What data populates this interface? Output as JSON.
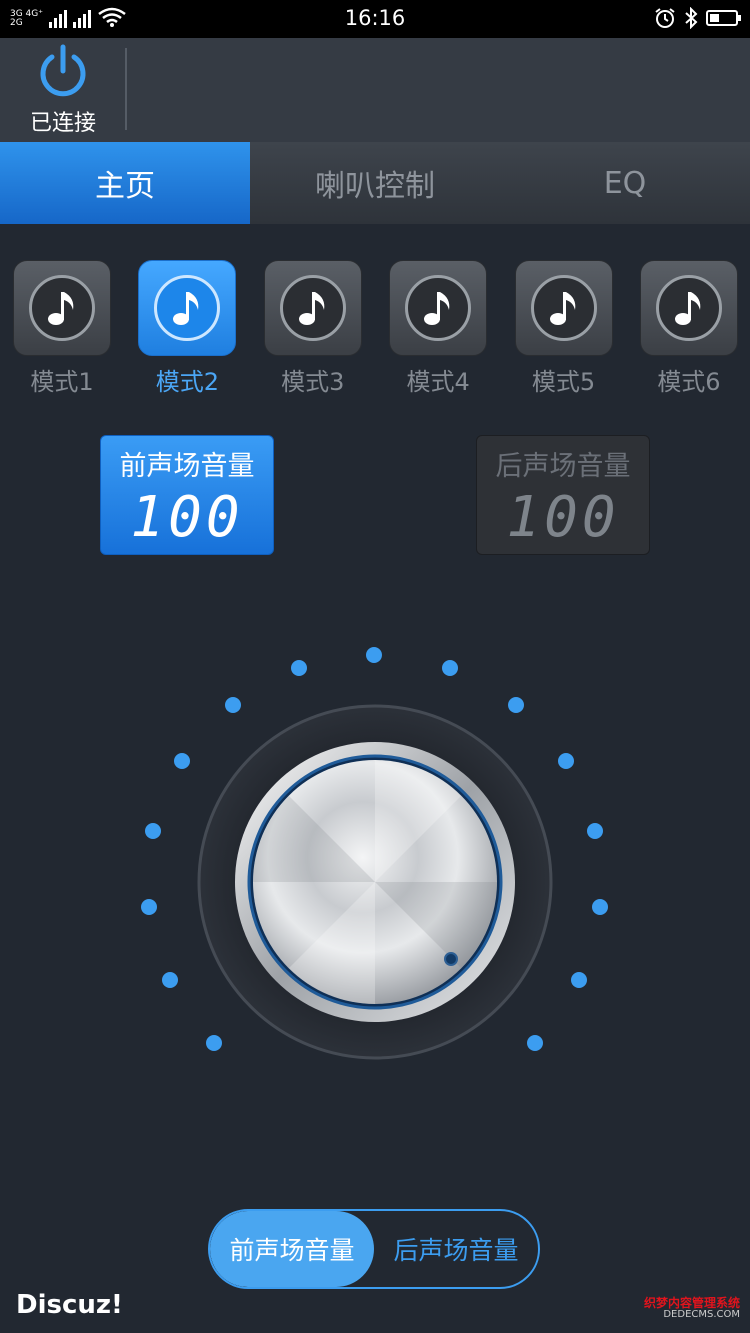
{
  "status_bar": {
    "time": "16:16",
    "net_top": "3G 4G⁺",
    "net_bottom": "2G"
  },
  "header": {
    "connection_label": "已连接"
  },
  "tabs": [
    {
      "label": "主页",
      "active": true
    },
    {
      "label": "喇叭控制",
      "active": false
    },
    {
      "label": "EQ",
      "active": false
    }
  ],
  "modes": [
    {
      "label": "模式1",
      "active": false
    },
    {
      "label": "模式2",
      "active": true
    },
    {
      "label": "模式3",
      "active": false
    },
    {
      "label": "模式4",
      "active": false
    },
    {
      "label": "模式5",
      "active": false
    },
    {
      "label": "模式6",
      "active": false
    }
  ],
  "volume": {
    "front": {
      "title": "前声场音量",
      "value": "100"
    },
    "back": {
      "title": "后声场音量",
      "value": "100"
    }
  },
  "toggle": {
    "front_label": "前声场音量",
    "back_label": "后声场音量"
  },
  "footer": {
    "brand": "Discuz!",
    "watermark_line1": "织梦内容管理系统",
    "watermark_line2": "DEDECMS.COM"
  },
  "colors": {
    "accent": "#3c9df0",
    "tab_active": "#1e7fe0",
    "background": "#222831"
  },
  "icons": [
    "power-icon",
    "music-note-icon",
    "wifi-icon",
    "alarm-icon",
    "bluetooth-icon",
    "battery-icon"
  ]
}
